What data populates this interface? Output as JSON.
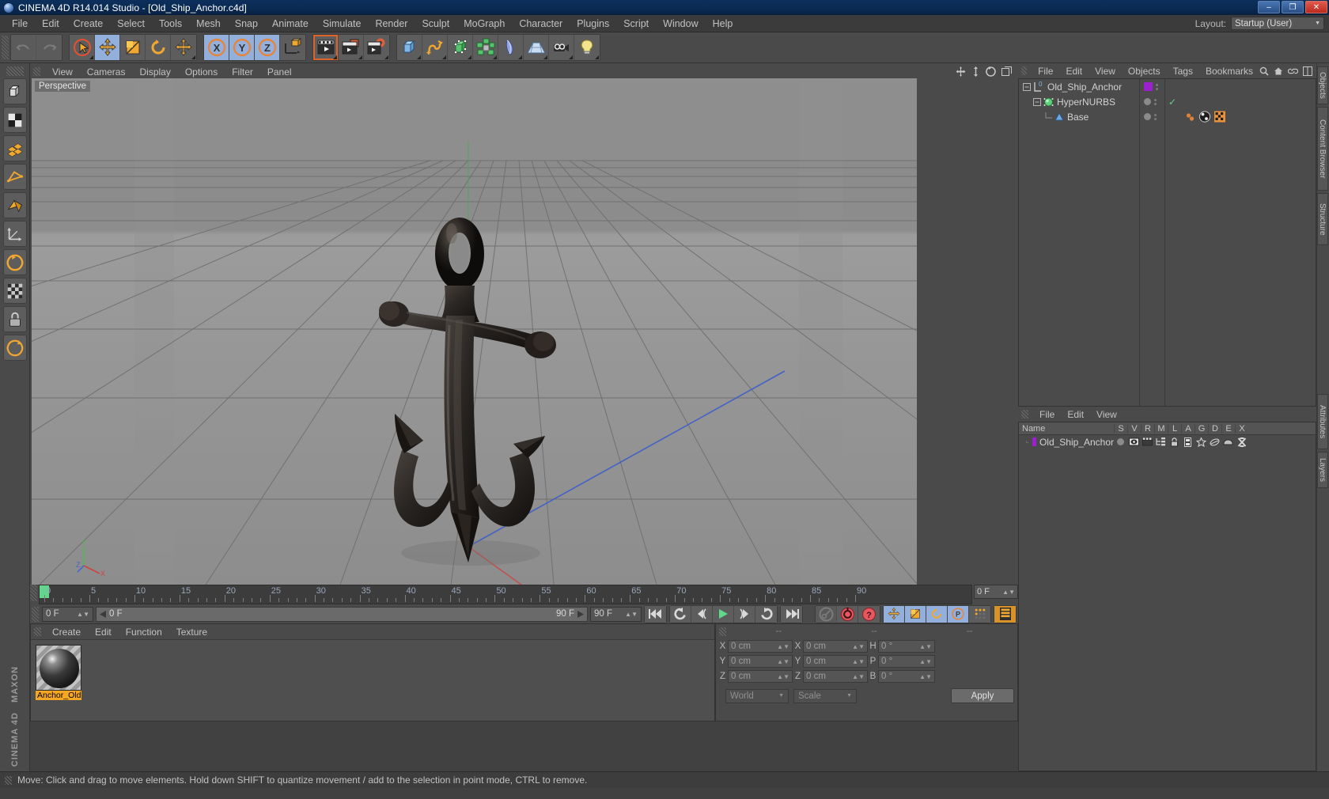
{
  "window": {
    "title": "CINEMA 4D R14.014 Studio - [Old_Ship_Anchor.c4d]",
    "minimize": "–",
    "maximize": "❐",
    "close": "✕"
  },
  "menubar": {
    "items": [
      "File",
      "Edit",
      "Create",
      "Select",
      "Tools",
      "Mesh",
      "Snap",
      "Animate",
      "Simulate",
      "Render",
      "Sculpt",
      "MoGraph",
      "Character",
      "Plugins",
      "Script",
      "Window",
      "Help"
    ],
    "layout_label": "Layout:",
    "layout_value": "Startup (User)"
  },
  "toolbar": {
    "groups": [
      {
        "name": "history",
        "buttons": [
          {
            "icon": "undo-icon",
            "state": "disabled"
          },
          {
            "icon": "redo-icon",
            "state": "disabled"
          }
        ]
      },
      {
        "name": "selection",
        "buttons": [
          {
            "icon": "live-selection-icon",
            "state": "normal"
          },
          {
            "icon": "move-icon",
            "state": "selected"
          },
          {
            "icon": "scale-icon",
            "state": "normal"
          },
          {
            "icon": "rotate-icon",
            "state": "normal"
          },
          {
            "icon": "axis-move-icon",
            "state": "normal"
          }
        ]
      },
      {
        "name": "axis-lock",
        "buttons": [
          {
            "icon": "x-axis-icon",
            "state": "selected"
          },
          {
            "icon": "y-axis-icon",
            "state": "selected"
          },
          {
            "icon": "z-axis-icon",
            "state": "selected"
          },
          {
            "icon": "world-coord-icon",
            "state": "normal"
          }
        ]
      },
      {
        "name": "render",
        "buttons": [
          {
            "icon": "render-view-icon",
            "state": "active-out"
          },
          {
            "icon": "render-region-icon",
            "state": "normal"
          },
          {
            "icon": "render-settings-icon",
            "state": "normal"
          }
        ]
      },
      {
        "name": "create",
        "buttons": [
          {
            "icon": "cube-primitive-icon",
            "state": "normal"
          },
          {
            "icon": "spline-pen-icon",
            "state": "normal"
          },
          {
            "icon": "nurbs-icon",
            "state": "normal"
          },
          {
            "icon": "array-icon",
            "state": "normal"
          },
          {
            "icon": "bend-deformer-icon",
            "state": "normal"
          },
          {
            "icon": "floor-icon",
            "state": "normal"
          },
          {
            "icon": "camera-icon",
            "state": "normal"
          },
          {
            "icon": "light-icon",
            "state": "normal"
          }
        ]
      }
    ]
  },
  "leftrail": {
    "buttons": [
      {
        "icon": "model-mode-icon"
      },
      {
        "icon": "texture-mode-icon"
      },
      {
        "icon": "points-mode-icon"
      },
      {
        "icon": "edges-mode-icon"
      },
      {
        "icon": "polygons-mode-icon"
      },
      {
        "icon": "axis-mode-icon"
      },
      {
        "icon": "enable-axis-icon"
      },
      {
        "icon": "viewport-solo-icon"
      },
      {
        "icon": "lock-axis-icon"
      },
      {
        "icon": "workplane-icon"
      }
    ],
    "brand_top": "MAXON",
    "brand_bottom": "CINEMA 4D"
  },
  "viewport": {
    "menu": [
      "View",
      "Cameras",
      "Display",
      "Options",
      "Filter",
      "Panel"
    ],
    "label": "Perspective",
    "nav_icons": [
      "move-camera-icon",
      "scale-camera-icon",
      "rotate-camera-icon",
      "maximize-view-icon"
    ],
    "axis_gizmo": {
      "x": "X",
      "y": "Y",
      "z": "Z"
    },
    "scene_object": "Old_Ship_Anchor"
  },
  "timeline": {
    "ticks": [
      0,
      5,
      10,
      15,
      20,
      25,
      30,
      35,
      40,
      45,
      50,
      55,
      60,
      65,
      70,
      75,
      80,
      85,
      90
    ],
    "current_frame": "0 F",
    "start_field": "0 F",
    "track_start": "0 F",
    "track_end": "90 F",
    "end_field": "90 F",
    "playback": [
      {
        "icon": "goto-start-icon"
      },
      {
        "icon": "play-backwards-loop-icon"
      },
      {
        "icon": "step-back-icon"
      },
      {
        "icon": "play-icon"
      },
      {
        "icon": "step-forward-icon"
      },
      {
        "icon": "loop-icon"
      },
      {
        "icon": "goto-end-icon"
      }
    ],
    "record_tools": [
      {
        "icon": "autokey-icon"
      },
      {
        "icon": "record-icon"
      },
      {
        "icon": "keyframe-selection-icon"
      }
    ],
    "key_toggles": [
      {
        "icon": "position-key-icon",
        "state": "selected"
      },
      {
        "icon": "scale-key-icon",
        "state": "selected"
      },
      {
        "icon": "rotation-key-icon",
        "state": "selected"
      },
      {
        "icon": "param-key-icon",
        "state": "selected"
      },
      {
        "icon": "point-level-anim-icon",
        "state": "normal"
      }
    ],
    "timeline_toggle": {
      "icon": "timeline-view-icon"
    }
  },
  "material_manager": {
    "menu": [
      "Create",
      "Edit",
      "Function",
      "Texture"
    ],
    "materials": [
      {
        "name": "Anchor_Old",
        "thumb": "sphere-preview"
      }
    ]
  },
  "coordinates": {
    "headers": [
      "--",
      "--",
      "--"
    ],
    "position": {
      "label_x": "X",
      "x": "0 cm",
      "label_y": "Y",
      "y": "0 cm",
      "label_z": "Z",
      "z": "0 cm"
    },
    "size": {
      "label_x": "X",
      "x": "0 cm",
      "label_y": "Y",
      "y": "0 cm",
      "label_z": "Z",
      "z": "0 cm"
    },
    "rotation": {
      "label_h": "H",
      "h": "0 °",
      "label_p": "P",
      "p": "0 °",
      "label_b": "B",
      "b": "0 °"
    },
    "system": "World",
    "mode": "Scale",
    "apply": "Apply"
  },
  "object_manager": {
    "menu": [
      "File",
      "Edit",
      "View",
      "Objects",
      "Tags",
      "Bookmarks"
    ],
    "header_icons": [
      "search-icon",
      "home-icon",
      "link-icon",
      "layout-icon"
    ],
    "items": [
      {
        "name": "Old_Ship_Anchor",
        "icon": "null-object-icon",
        "depth": 0,
        "color": "#9a20d0",
        "visible_dot": true,
        "check": false
      },
      {
        "name": "HyperNURBS",
        "icon": "hypernurbs-icon",
        "depth": 1,
        "color": "#7fd17f",
        "visible_dot": true,
        "check": true
      },
      {
        "name": "Base",
        "icon": "polygon-object-icon",
        "depth": 2,
        "color": "#6fa8e8",
        "visible_dot": true,
        "check": false
      }
    ],
    "tags": [
      "phong-tag-icon",
      "texture-tag-icon",
      "uvw-tag-icon"
    ]
  },
  "layer_manager": {
    "menu": [
      "File",
      "Edit",
      "View"
    ],
    "columns": [
      "Name",
      "S",
      "V",
      "R",
      "M",
      "L",
      "A",
      "G",
      "D",
      "E",
      "X"
    ],
    "rows": [
      {
        "name": "Old_Ship_Anchor",
        "color": "#9a20d0"
      }
    ]
  },
  "right_tabs": [
    "Objects",
    "Content Browser",
    "Structure",
    "Attributes",
    "Layers"
  ],
  "status": {
    "message": "Move: Click and drag to move elements. Hold down SHIFT to quantize movement / add to the selection in point mode, CTRL to remove."
  },
  "colors": {
    "accent_orange": "#f5a623",
    "selected_blue": "#93b0dc",
    "green": "#63d68d",
    "red_axis": "#cc4444",
    "green_axis": "#4fbb4f",
    "blue_axis": "#4466cc",
    "layer_purple": "#9a20d0"
  }
}
